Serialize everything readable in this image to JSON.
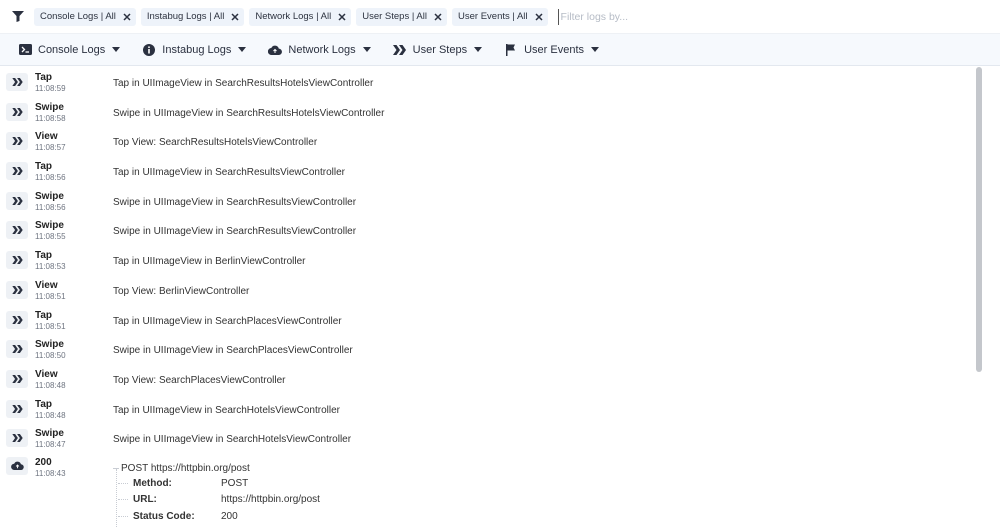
{
  "filter": {
    "chips": [
      {
        "label": "Console Logs | All"
      },
      {
        "label": "Instabug Logs | All"
      },
      {
        "label": "Network Logs | All"
      },
      {
        "label": "User Steps | All"
      },
      {
        "label": "User Events | All"
      }
    ],
    "placeholder": "Filter logs by..."
  },
  "toolbar": {
    "items": [
      {
        "label": "Console Logs",
        "icon": "terminal-icon"
      },
      {
        "label": "Instabug Logs",
        "icon": "info-icon"
      },
      {
        "label": "Network Logs",
        "icon": "cloud-icon"
      },
      {
        "label": "User Steps",
        "icon": "steps-icon"
      },
      {
        "label": "User Events",
        "icon": "flag-icon"
      }
    ]
  },
  "logs": [
    {
      "type": "Tap",
      "time": "11:08:59",
      "message": "Tap in UIImageView in SearchResultsHotelsViewController"
    },
    {
      "type": "Swipe",
      "time": "11:08:58",
      "message": "Swipe in UIImageView in SearchResultsHotelsViewController"
    },
    {
      "type": "View",
      "time": "11:08:57",
      "message": "Top View: SearchResultsHotelsViewController"
    },
    {
      "type": "Tap",
      "time": "11:08:56",
      "message": "Tap in UIImageView in SearchResultsViewController"
    },
    {
      "type": "Swipe",
      "time": "11:08:56",
      "message": "Swipe in UIImageView in SearchResultsViewController"
    },
    {
      "type": "Swipe",
      "time": "11:08:55",
      "message": "Swipe in UIImageView in SearchResultsViewController"
    },
    {
      "type": "Tap",
      "time": "11:08:53",
      "message": "Tap in UIImageView in BerlinViewController"
    },
    {
      "type": "View",
      "time": "11:08:51",
      "message": "Top View: BerlinViewController"
    },
    {
      "type": "Tap",
      "time": "11:08:51",
      "message": "Tap in UIImageView in SearchPlacesViewController"
    },
    {
      "type": "Swipe",
      "time": "11:08:50",
      "message": "Swipe in UIImageView in SearchPlacesViewController"
    },
    {
      "type": "View",
      "time": "11:08:48",
      "message": "Top View: SearchPlacesViewController"
    },
    {
      "type": "Tap",
      "time": "11:08:48",
      "message": "Tap in UIImageView in SearchHotelsViewController"
    },
    {
      "type": "Swipe",
      "time": "11:08:47",
      "message": "Swipe in UIImageView in SearchHotelsViewController"
    }
  ],
  "network": {
    "type": "200",
    "time": "11:08:43",
    "request": "POST https://httpbin.org/post",
    "fields": [
      {
        "key": "Method:",
        "value": "POST"
      },
      {
        "key": "URL:",
        "value": "https://httpbin.org/post"
      },
      {
        "key": "Status Code:",
        "value": "200"
      }
    ]
  },
  "colors": {
    "chip_bg": "#eef3fa",
    "toolbar_bg": "#f6f9fd",
    "icon_dark": "#2b3140"
  }
}
